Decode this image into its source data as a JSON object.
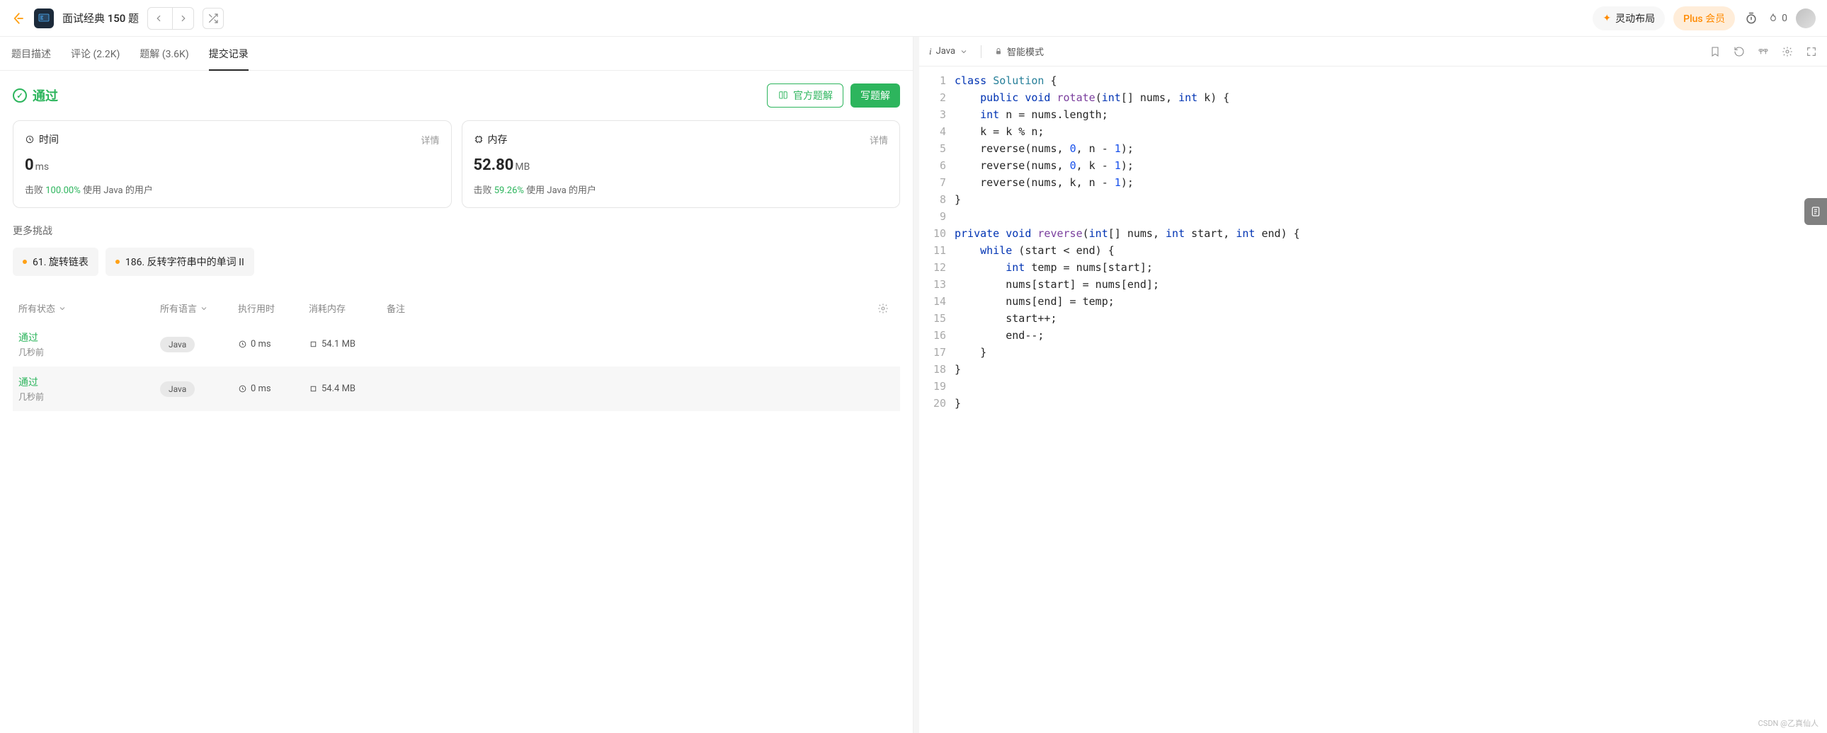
{
  "header": {
    "title": "面试经典 150 题",
    "layout_btn": "灵动布局",
    "plus_btn": "Plus 会员",
    "streak": "0"
  },
  "tabs": {
    "t1": "题目描述",
    "t2": "评论 (2.2K)",
    "t3": "题解 (3.6K)",
    "t4": "提交记录"
  },
  "result": {
    "status": "通过",
    "official_btn": "官方题解",
    "write_btn": "写题解"
  },
  "metrics": {
    "time_label": "时间",
    "detail": "详情",
    "time_value": "0",
    "time_unit": "ms",
    "time_beats_pre": "击败",
    "time_beats": "100.00%",
    "time_beats_post": "使用 Java 的用户",
    "mem_label": "内存",
    "mem_value": "52.80",
    "mem_unit": "MB",
    "mem_beats_pre": "击败",
    "mem_beats": "59.26%",
    "mem_beats_post": "使用 Java 的用户"
  },
  "challenges": {
    "title": "更多挑战",
    "c1": "61. 旋转链表",
    "c2": "186. 反转字符串中的单词 II"
  },
  "table": {
    "h_status": "所有状态",
    "h_lang": "所有语言",
    "h_time": "执行用时",
    "h_mem": "消耗内存",
    "h_note": "备注",
    "rows": [
      {
        "status": "通过",
        "ago": "几秒前",
        "lang": "Java",
        "time": "0 ms",
        "mem": "54.1 MB"
      },
      {
        "status": "通过",
        "ago": "几秒前",
        "lang": "Java",
        "time": "0 ms",
        "mem": "54.4 MB"
      }
    ]
  },
  "editor": {
    "language": "Java",
    "mode": "智能模式",
    "code": {
      "l1": "class Solution {",
      "l2": "    public void rotate(int[] nums, int k) {",
      "l3": "    int n = nums.length;",
      "l4": "    k = k % n;",
      "l5": "    reverse(nums, 0, n - 1);",
      "l6": "    reverse(nums, 0, k - 1);",
      "l7": "    reverse(nums, k, n - 1);",
      "l8": "}",
      "l9": "",
      "l10": "private void reverse(int[] nums, int start, int end) {",
      "l11": "    while (start < end) {",
      "l12": "        int temp = nums[start];",
      "l13": "        nums[start] = nums[end];",
      "l14": "        nums[end] = temp;",
      "l15": "        start++;",
      "l16": "        end--;",
      "l17": "    }",
      "l18": "}",
      "l19": "",
      "l20": "}"
    }
  },
  "watermark": "CSDN @乙真仙人"
}
